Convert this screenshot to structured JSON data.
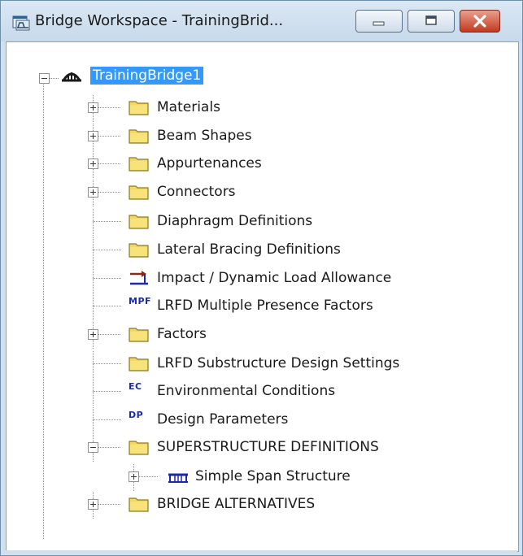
{
  "window": {
    "title": "Bridge Workspace - TrainingBrid...",
    "app_icon": "bridge-workspace-icon"
  },
  "caption_buttons": {
    "minimize": "minimize-icon",
    "maximize": "maximize-icon",
    "close": "close-icon"
  },
  "tree": {
    "root": {
      "label": "TrainingBridge1",
      "icon": "bridge-arch-icon"
    },
    "items": [
      {
        "label": "Materials",
        "icon": "folder-icon",
        "expander": "plus"
      },
      {
        "label": "Beam Shapes",
        "icon": "folder-icon",
        "expander": "plus"
      },
      {
        "label": "Appurtenances",
        "icon": "folder-icon",
        "expander": "plus"
      },
      {
        "label": "Connectors",
        "icon": "folder-icon",
        "expander": "plus"
      },
      {
        "label": "Diaphragm Definitions",
        "icon": "folder-icon",
        "expander": "none"
      },
      {
        "label": "Lateral Bracing Definitions",
        "icon": "folder-icon",
        "expander": "none"
      },
      {
        "label": "Impact / Dynamic Load Allowance",
        "icon": "impact-load-icon",
        "expander": "none"
      },
      {
        "label": "LRFD Multiple Presence Factors",
        "icon": "mpf-icon",
        "icon_text": "MPF",
        "expander": "none"
      },
      {
        "label": "Factors",
        "icon": "folder-icon",
        "expander": "plus"
      },
      {
        "label": "LRFD Substructure Design Settings",
        "icon": "folder-icon",
        "expander": "none"
      },
      {
        "label": "Environmental Conditions",
        "icon": "ec-icon",
        "icon_text": "EC",
        "expander": "none"
      },
      {
        "label": "Design Parameters",
        "icon": "dp-icon",
        "icon_text": "DP",
        "expander": "none"
      },
      {
        "label": "SUPERSTRUCTURE DEFINITIONS",
        "icon": "folder-icon",
        "expander": "minus"
      },
      {
        "label": "Simple Span Structure",
        "icon": "span-structure-icon",
        "expander": "plus"
      },
      {
        "label": "BRIDGE ALTERNATIVES",
        "icon": "folder-icon",
        "expander": "plus"
      }
    ]
  },
  "colors": {
    "selection": "#3399ff",
    "icon_text": "#1b2aa8",
    "folder": "#f4d860"
  }
}
